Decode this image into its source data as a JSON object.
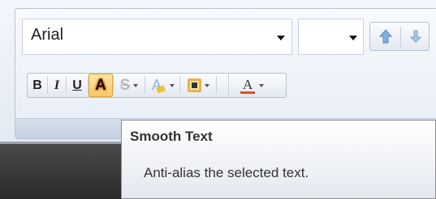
{
  "font_group": {
    "font_name": "Arial",
    "font_size": "",
    "grow_font_icon": "grow-font-icon",
    "shrink_font_icon": "shrink-font-icon"
  },
  "format_buttons": {
    "bold": "B",
    "italic": "I",
    "underline": "U",
    "smooth_text": "A",
    "strikethrough": "S",
    "highlight": "A",
    "font_color": "A"
  },
  "colors": {
    "font_color_bar": "#e84b1f",
    "highlight_bar": "#f2c230",
    "smooth_text_glow": "#d84b1c"
  },
  "tooltip": {
    "title": "Smooth Text",
    "description": "Anti-alias the selected text."
  }
}
